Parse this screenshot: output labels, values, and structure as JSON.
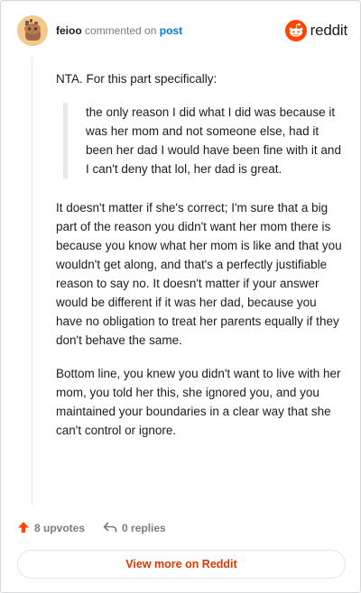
{
  "header": {
    "username": "feioo",
    "commented_on": "commented on",
    "post_link": "post",
    "brand": "reddit"
  },
  "comment": {
    "intro": "NTA. For this part specifically:",
    "quote": "the only reason I did what I did was because it was her mom and not someone else, had it been her dad I would have been fine with it and I can't deny that lol, her dad is great.",
    "paragraphs": [
      "It doesn't matter if she's correct; I'm sure that a big part of the reason you didn't want her mom there is because you know what her mom is like and that you wouldn't get along, and that's a perfectly justifiable reason to say no. It doesn't matter if your answer would be different if it was her dad, because you have no obligation to treat her parents equally if they don't behave the same.",
      "Bottom line, you knew you didn't want to live with her mom, you told her this, she ignored you, and you maintained your boundaries in a clear way that she can't control or ignore."
    ]
  },
  "footer": {
    "upvotes": "8 upvotes",
    "replies": "0 replies",
    "view_more": "View more on Reddit"
  },
  "colors": {
    "brand_orange": "#ff4500",
    "link_blue": "#0079d3",
    "cta_text": "#d93a00"
  }
}
